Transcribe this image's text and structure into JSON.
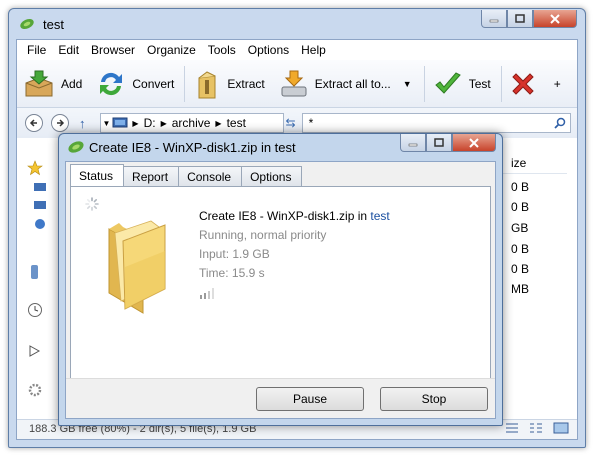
{
  "window": {
    "title": "test"
  },
  "menu": [
    "File",
    "Edit",
    "Browser",
    "Organize",
    "Tools",
    "Options",
    "Help"
  ],
  "toolbar": {
    "add": "Add",
    "convert": "Convert",
    "extract": "Extract",
    "extract_all": "Extract all to...",
    "test": "Test",
    "more": "+"
  },
  "address": {
    "segments": [
      "D:",
      "archive",
      "test"
    ],
    "filter": "*"
  },
  "file_list": {
    "size_header": "ize",
    "sizes": [
      "0 B",
      "0 B",
      "GB",
      "0 B",
      "0 B",
      "MB"
    ]
  },
  "status": {
    "text": "188.3 GB free (80%) - 2 dir(s), 5 file(s), 1.9 GB"
  },
  "dialog": {
    "title": "Create IE8 - WinXP-disk1.zip in test",
    "tabs": [
      "Status",
      "Report",
      "Console",
      "Options"
    ],
    "operation_prefix": "Create IE8 - WinXP-disk1.zip in ",
    "operation_link": "test",
    "state": "Running, normal priority",
    "input": "Input:  1.9 GB",
    "time": "Time:  15.9 s",
    "progress": 0,
    "pause": "Pause",
    "stop": "Stop"
  },
  "colors": {
    "accent": "#3a6bb0",
    "link": "#1a4fa0",
    "window_frame": "#c9d9ee"
  }
}
